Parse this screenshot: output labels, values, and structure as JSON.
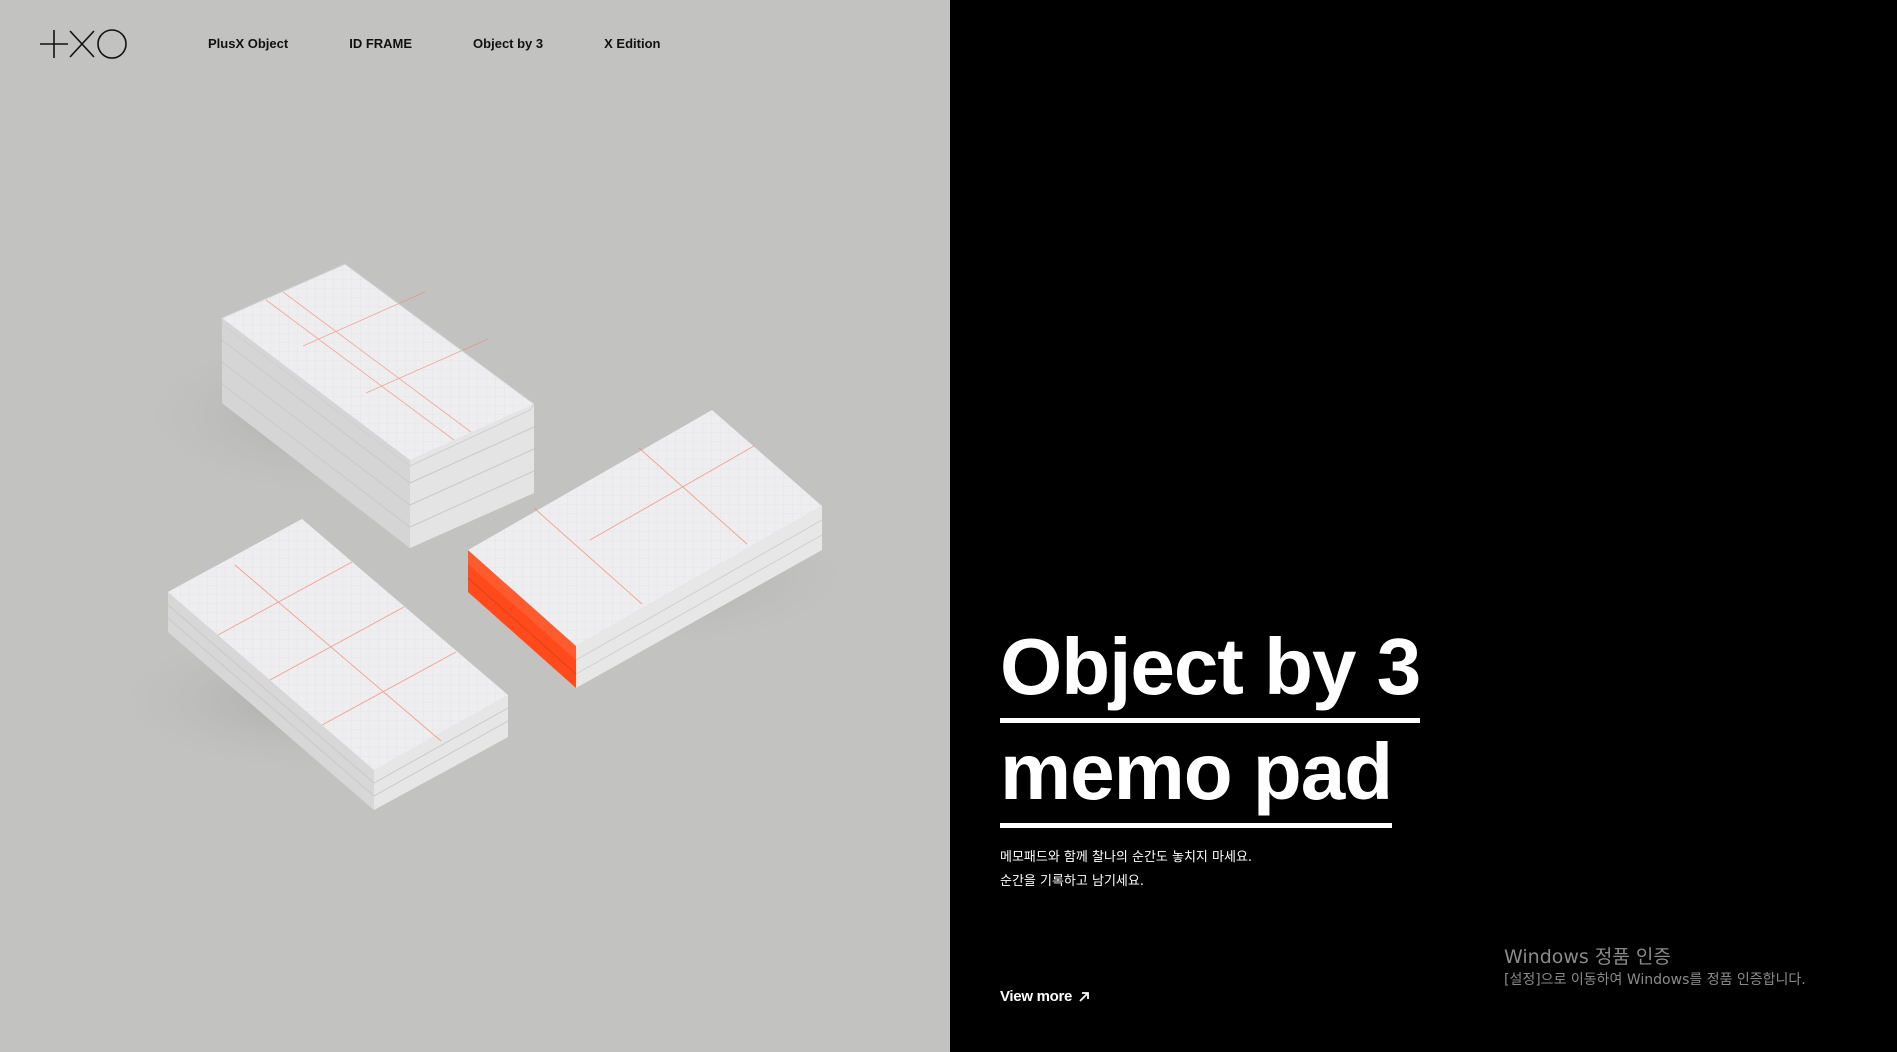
{
  "nav": {
    "items": [
      {
        "label": "PlusX Object"
      },
      {
        "label": "ID FRAME"
      },
      {
        "label": "Object by 3"
      },
      {
        "label": "X Edition"
      }
    ]
  },
  "hero": {
    "title_line1": "Object by 3",
    "title_line2": "memo pad",
    "description_line1": "메모패드와 함께 찰나의 순간도 놓치지 마세요.",
    "description_line2": "순간을 기록하고 남기세요.",
    "cta_label": "View more"
  },
  "os_watermark": {
    "title": "Windows 정품 인증",
    "subtitle": "[설정]으로 이동하여 Windows를 정품 인증합니다."
  },
  "icons": {
    "logo": "plusx-logo",
    "cta_arrow": "arrow-up-right-icon"
  },
  "colors": {
    "left_panel_bg": "#c2c2c1",
    "right_panel_bg": "#000000",
    "accent": "#ff4a1c",
    "paper": "#efeeef"
  }
}
